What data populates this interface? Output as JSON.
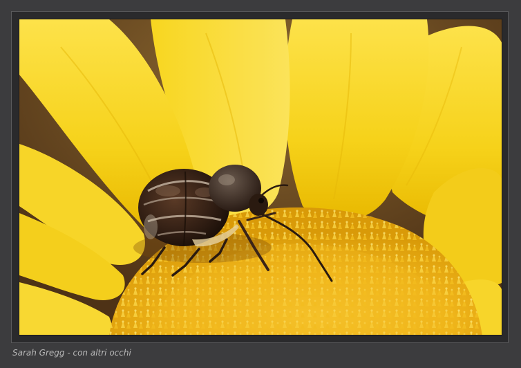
{
  "caption": {
    "text": "Sarah Gregg - con altri occhi"
  },
  "photo": {
    "subject": "beetle-on-yellow-flower",
    "colors": {
      "petal": "#f6d21a",
      "petal_shadow": "#e0b400",
      "center": "#f2b417",
      "background": "#6e4a22",
      "beetle_body": "#3a2418",
      "beetle_pattern": "#c9b9a6",
      "frame_bg": "#3c3c3e"
    }
  }
}
